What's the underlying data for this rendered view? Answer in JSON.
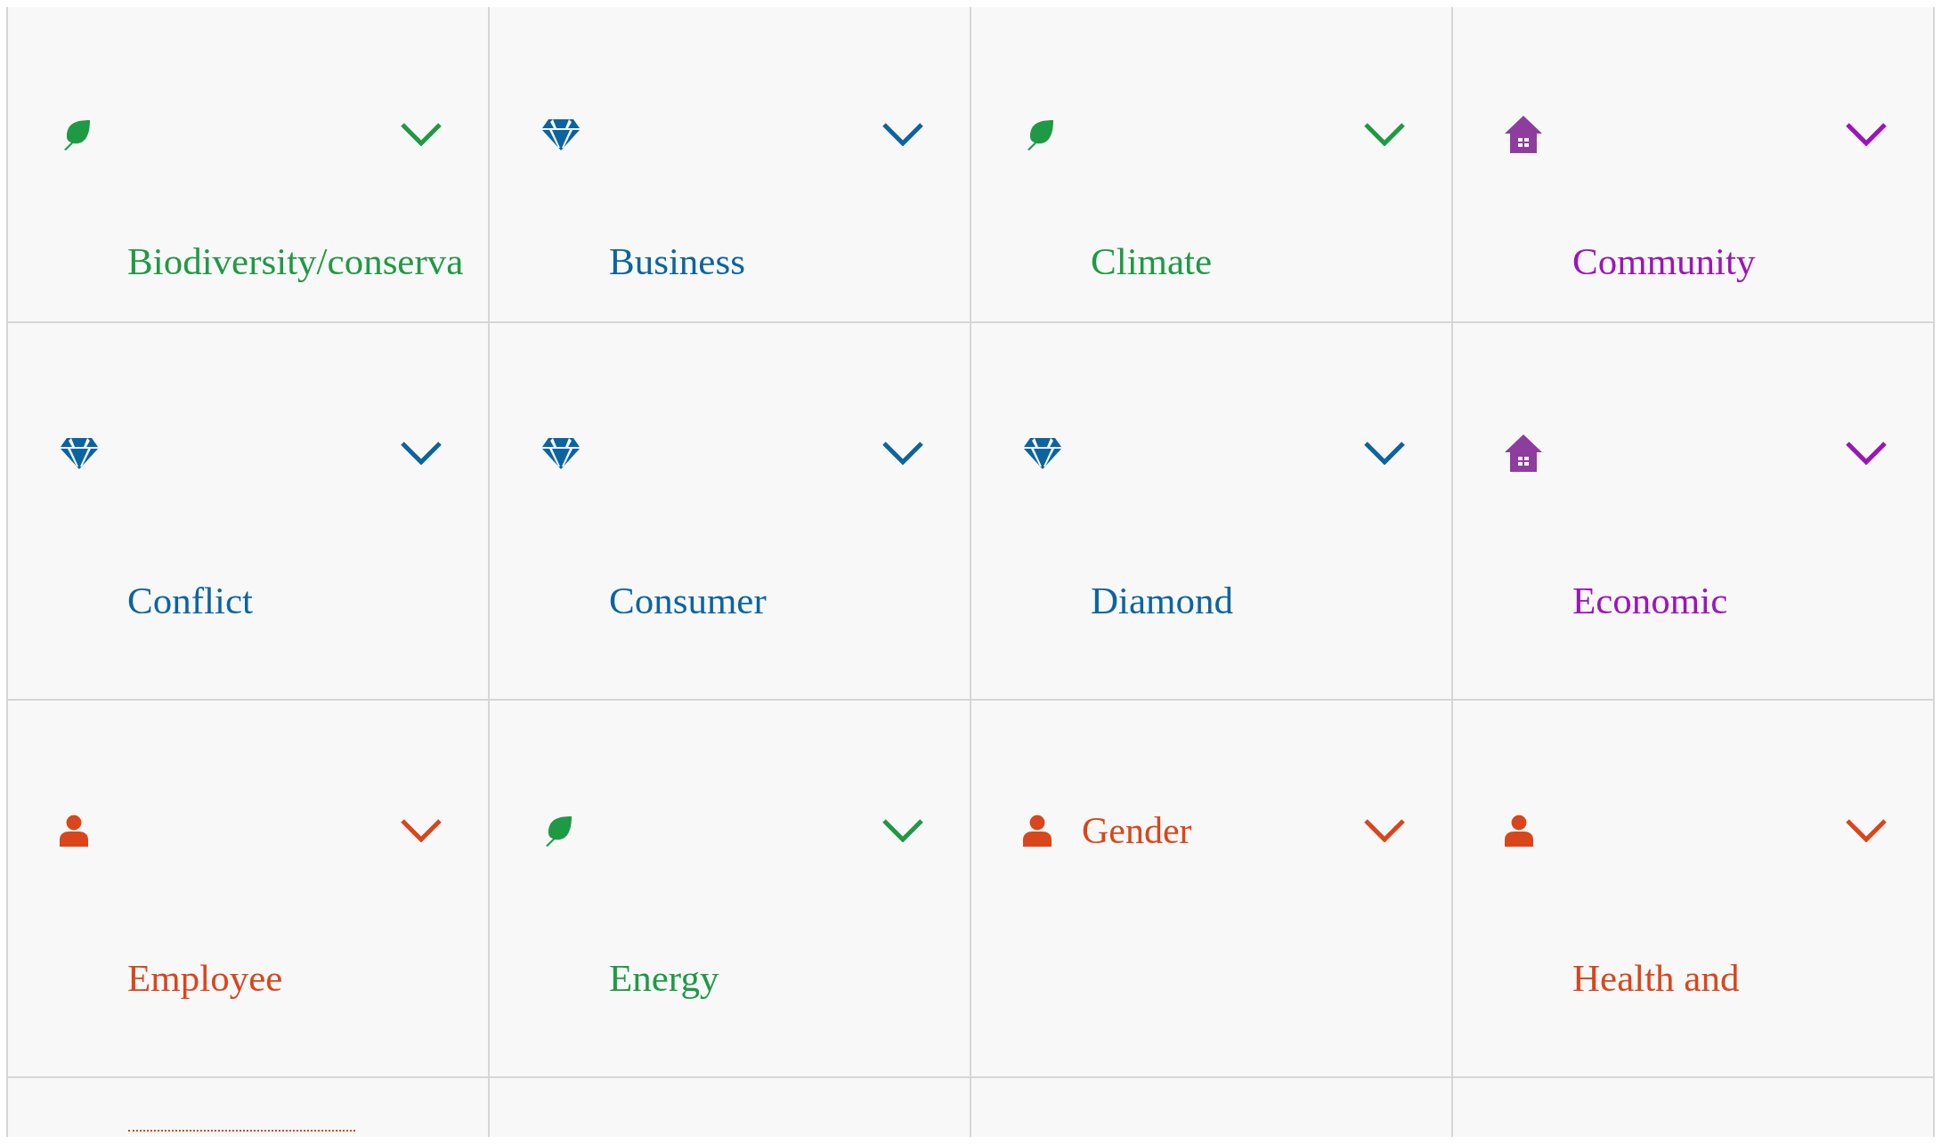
{
  "cards": [
    {
      "label": "Biodiversity/conserva",
      "color": "#1e9a44",
      "kind": "leaf"
    },
    {
      "label": "Business",
      "color": "#0b64a0",
      "kind": "diamond"
    },
    {
      "label": "Climate",
      "color": "#1e9a44",
      "kind": "leaf"
    },
    {
      "label": "Community",
      "color": "#9c14bb",
      "kind": "house"
    },
    {
      "label": "Conflict",
      "color": "#0b64a0",
      "kind": "diamond"
    },
    {
      "label": "Consumer",
      "color": "#0b64a0",
      "kind": "diamond"
    },
    {
      "label": "Diamond",
      "color": "#0b64a0",
      "kind": "diamond"
    },
    {
      "label": "Economic",
      "color": "#9c14bb",
      "kind": "house"
    },
    {
      "label": "Employee",
      "color": "#d9461b",
      "kind": "person"
    },
    {
      "label": "Energy",
      "color": "#1e9a44",
      "kind": "leaf"
    },
    {
      "label": "Gender",
      "color": "#d9461b",
      "kind": "person-inline"
    },
    {
      "label": "Health and",
      "color": "#d9461b",
      "kind": "person"
    }
  ],
  "partial_row": [
    {
      "color": "#d9461b"
    }
  ]
}
